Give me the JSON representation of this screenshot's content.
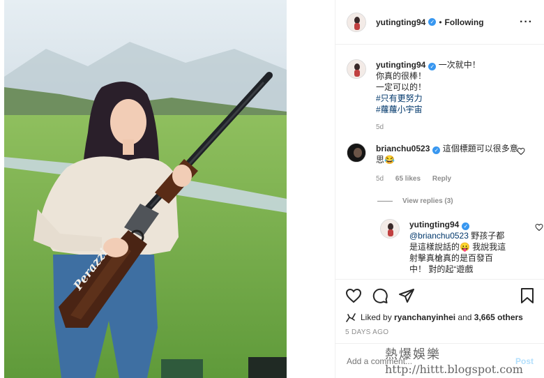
{
  "post": {
    "author": "yutingting94",
    "follow_label": "Following",
    "caption_lines": [
      "一次就中！",
      "你真的很棒！",
      "一定可以的！"
    ],
    "hashtags": [
      "#只有更努力",
      "#蘿蘿小宇宙"
    ],
    "caption_age": "5d",
    "gun_brand": "Perazzi"
  },
  "comments": [
    {
      "user": "brianchu0523",
      "text": "這個標題可以很多意思😂",
      "age": "5d",
      "likes": "65 likes",
      "reply_label": "Reply"
    }
  ],
  "view_replies": "View replies (3)",
  "reply": {
    "user": "yutingting94",
    "mention": "@brianchu0523",
    "text": "野孩子都是這樣說話的😛 我說我這射擊真槍真的是百發百中！ 對的起“遊戲"
  },
  "likes_line": {
    "prefix": "Liked by",
    "user": "ryanchanyinhei",
    "and": "and",
    "others": "3,665 others"
  },
  "date": "5 DAYS AGO",
  "add_comment": {
    "placeholder": "Add a comment...",
    "post_label": "Post"
  },
  "watermark": {
    "title": "熱爆娛樂",
    "url": "http://hittt.blogspot.com"
  },
  "colors": {
    "link": "#00376b",
    "verified": "#3897f0",
    "post_disabled": "#b2dffc"
  }
}
